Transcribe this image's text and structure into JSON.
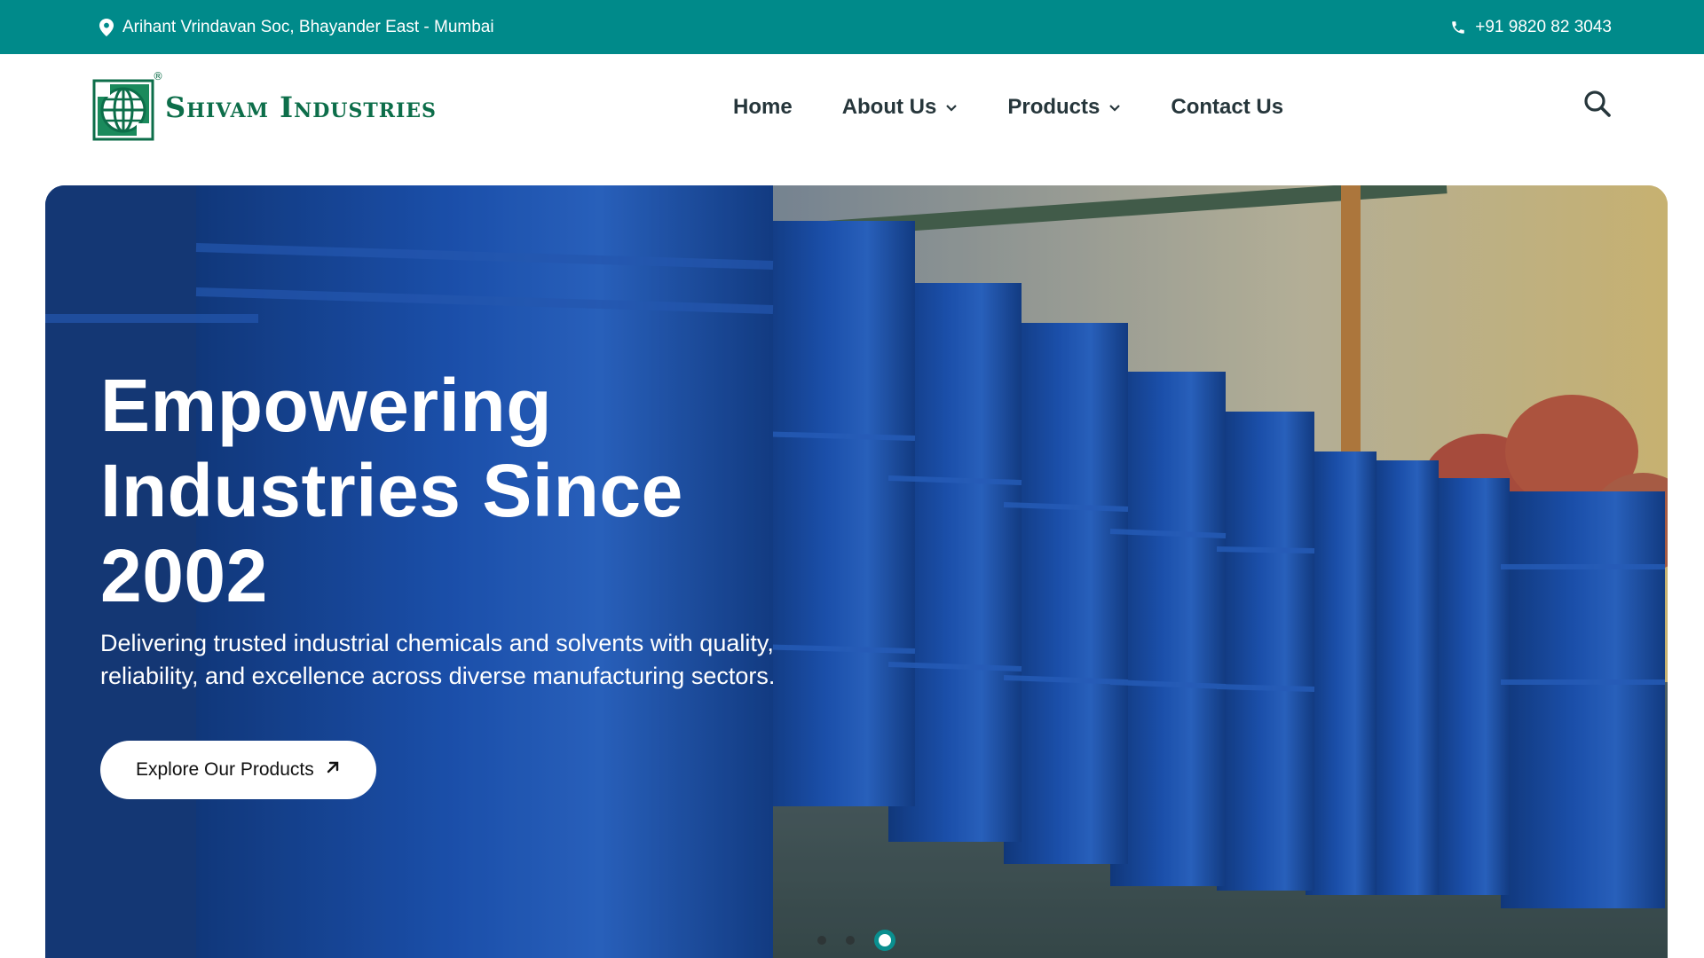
{
  "topbar": {
    "address": "Arihant Vrindavan Soc, Bhayander East - Mumbai",
    "phone": "+91 9820 82 3043",
    "address_icon": "map-pin-icon",
    "phone_icon": "phone-icon"
  },
  "brand": {
    "name": "Shivam Industries",
    "reg_mark": "®"
  },
  "nav": {
    "items": [
      {
        "label": "Home",
        "has_dropdown": false
      },
      {
        "label": "About Us",
        "has_dropdown": true
      },
      {
        "label": "Products",
        "has_dropdown": true
      },
      {
        "label": "Contact Us",
        "has_dropdown": false
      }
    ],
    "search_icon": "search-icon"
  },
  "hero": {
    "title_line1": "Empowering",
    "title_line2": "Industries Since",
    "title_line3": "2002",
    "subtitle": "Delivering trusted industrial chemicals and solvents with quality, reliability, and excellence across diverse manufacturing sectors.",
    "cta_label": "Explore Our Products",
    "cta_icon": "arrow-up-right-icon",
    "slides_total": 3,
    "active_slide": 3
  },
  "colors": {
    "accent": "#008a8a",
    "brand_green": "#0d6e4a",
    "nav_text": "#26363b"
  }
}
